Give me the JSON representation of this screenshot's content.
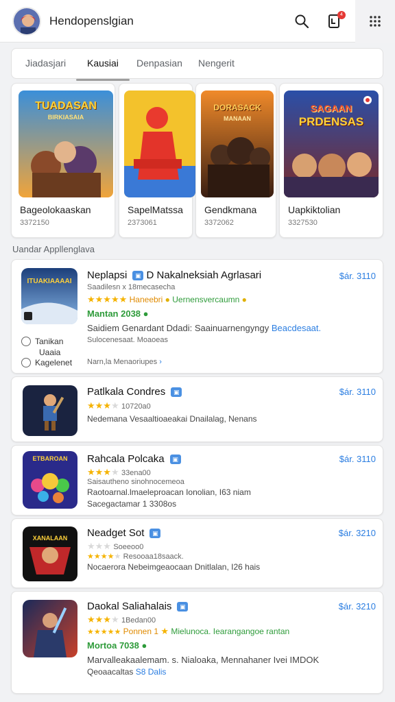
{
  "appbar": {
    "title": "Hendopenslgian",
    "icons": [
      "search-icon",
      "notification-icon",
      "grid-menu-icon"
    ],
    "badge": "4"
  },
  "tabs": [
    {
      "label": "Jiadasjari",
      "active": false
    },
    {
      "label": "Kausiai",
      "active": true
    },
    {
      "label": "Denpasian",
      "active": false
    },
    {
      "label": "Nengerit",
      "active": false
    }
  ],
  "featured": [
    {
      "name": "Bageolokaaskan",
      "count": "3372150",
      "art_text": "TUADASAN",
      "art_sub": "BIRKIASAIA"
    },
    {
      "name": "SapelMatssa",
      "count": "2373061",
      "art_text": "",
      "art_sub": ""
    },
    {
      "name": "Gendkmana",
      "count": "3372062",
      "art_text": "DORASACK",
      "art_sub": "MANAAN"
    },
    {
      "name": "Uapkiktolian",
      "count": "3327530",
      "art_text": "SAGAAN",
      "art_sub": "PRDENSAS"
    }
  ],
  "section_label": "Uandar Appllenglava",
  "items": [
    {
      "name": "Neplapsi",
      "name_extra": "D Nakalneksiah Agrlasari",
      "price": "$ár. 3110",
      "meta": "Saadilesn x 18mecasecha",
      "rating_text": "Haneebri",
      "rating_extra": "Uernensvercaumn",
      "version": "Mantan 2038",
      "desc": "Saidiem Genardant Ddadi: Saainuarnengyngy",
      "desc_link": "Beacdesaat.",
      "sub": "Sulocenesaat. Moaoeas",
      "link": "Narn,la Menaoriupes",
      "thumb_text": "ITUAKIAAAAI",
      "side": [
        "Tanikan",
        "Uaaia",
        "Kagelenet"
      ]
    },
    {
      "name": "Patlkala Condres",
      "price": "$ár. 3110",
      "meta": "10720a0",
      "stars": 3.5,
      "desc": "Nedemana Vesaaltioaeakai Dnailalag, Nenans"
    },
    {
      "name": "Rahcala Polcaka",
      "price": "$ár. 3110",
      "meta": "33ena00",
      "stars": 3.5,
      "sub": "Saisautheno sinohnocemeoa",
      "desc": "Raotoarnal.lmaeleproacan Ionolian, I63 niam",
      "sub2": "Sacegactamar 1 3308os",
      "thumb_text": "ETBAROAN"
    },
    {
      "name": "Neadget Sot",
      "price": "$ár. 3210",
      "meta": "Soeeoo0",
      "sub": "Resooaa18saack.",
      "desc": "Nocaerora Nebeimgeaocaan Dnitlalan, I26 hais",
      "thumb_text": "XANALAAN"
    },
    {
      "name": "Daokal Saliahalais",
      "price": "$ár. 3210",
      "meta": "1Bedan00",
      "rating_text": "Ponnen 1",
      "rating_extra": "Mielunoca. Iearangangoe rantan",
      "version": "Mortoa 7038",
      "desc": "Marvalleakaalemam. s. Nialoaka, Mennahaner Ivei IMDOK",
      "sub": "Qeoaacaltas",
      "sub_link": "S8 Dalis"
    }
  ],
  "colors": {
    "accent": "#2a7de1",
    "star": "#f5b301",
    "green": "#2e9b3a",
    "badge": "#e53935"
  }
}
